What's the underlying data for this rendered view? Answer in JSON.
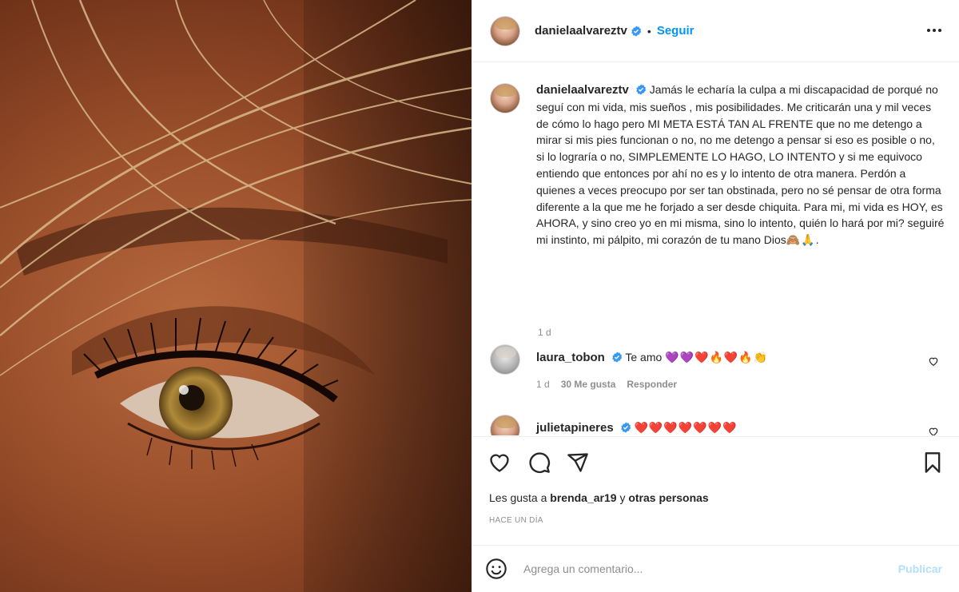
{
  "post": {
    "author": "danielaalvareztv",
    "follow_label": "Seguir",
    "dot": "•",
    "caption": {
      "text": "Jamás le echaría la culpa a mi discapacidad de porqué no seguí con mi vida, mis sueños , mis posibilidades. Me criticarán una y mil veces de cómo lo hago pero MI META ESTÁ TAN AL FRENTE que no me detengo a mirar si mis pies funcionan o no, no me detengo a pensar si eso es posible o no, si lo lograría o no, SIMPLEMENTE LO HAGO, LO INTENTO y si me equivoco entiendo que entonces por ahí no es y lo intento de otra manera. Perdón a quienes a veces preocupo por ser tan obstinada, pero no sé pensar de otra forma diferente a la que me he forjado a ser desde chiquita. Para mi, mi vida es HOY, es AHORA, y sino creo yo en mi misma, sino lo intento, quién lo hará por mi? seguiré mi instinto, mi pálpito, mi corazón de tu mano Dios",
      "emojis": "🙈🙏",
      "period": ".",
      "time": "1 d"
    },
    "comments": [
      {
        "user": "laura_tobon",
        "text": "Te amo",
        "emojis": "💜💜❤️🔥❤️🔥👏",
        "time": "1 d",
        "likes": "30 Me gusta",
        "reply_label": "Responder"
      },
      {
        "user": "julietapineres",
        "text": "",
        "emojis": "❤️❤️❤️❤️❤️❤️❤️"
      }
    ],
    "likes_prefix": "Les gusta a",
    "likes_user": "brenda_ar19",
    "likes_and": "y",
    "likes_others": "otras personas",
    "ago": "HACE UN DÍA"
  },
  "comment_box": {
    "placeholder": "Agrega un comentario...",
    "publish_label": "Publicar"
  },
  "icons": {
    "more": "more-dots-icon",
    "verified": "verified-badge-icon",
    "like": "heart-icon",
    "comment": "comment-bubble-icon",
    "share": "paper-plane-icon",
    "save": "bookmark-icon",
    "emoji": "smiley-icon"
  },
  "colors": {
    "accent": "#0095f6",
    "muted": "#8e8e8e",
    "text": "#262626",
    "publish_disabled": "#b2dffc"
  }
}
